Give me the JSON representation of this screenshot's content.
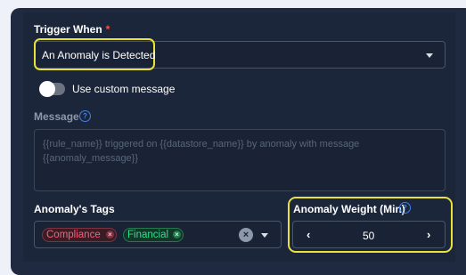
{
  "trigger": {
    "label": "Trigger When",
    "required_mark": "*",
    "selected_value": "An Anomaly is Detected",
    "highlight_color": "#e8e23a"
  },
  "custom_message": {
    "label": "Use custom message",
    "enabled": false
  },
  "message": {
    "label": "Message",
    "placeholder": "{{rule_name}} triggered on {{datastore_name}} by anomaly with message {{anomaly_message}}"
  },
  "tags": {
    "label": "Anomaly's Tags",
    "items": [
      {
        "label": "Compliance",
        "color": "#ff5c7a"
      },
      {
        "label": "Financial",
        "color": "#2ee08a"
      }
    ]
  },
  "weight": {
    "label": "Anomaly Weight (Min)",
    "value": "50",
    "decrement_glyph": "‹",
    "increment_glyph": "›"
  },
  "icons": {
    "help": "help-circle-icon",
    "caret": "chevron-down-icon",
    "chip_remove": "close-icon",
    "clear": "clear-icon"
  }
}
